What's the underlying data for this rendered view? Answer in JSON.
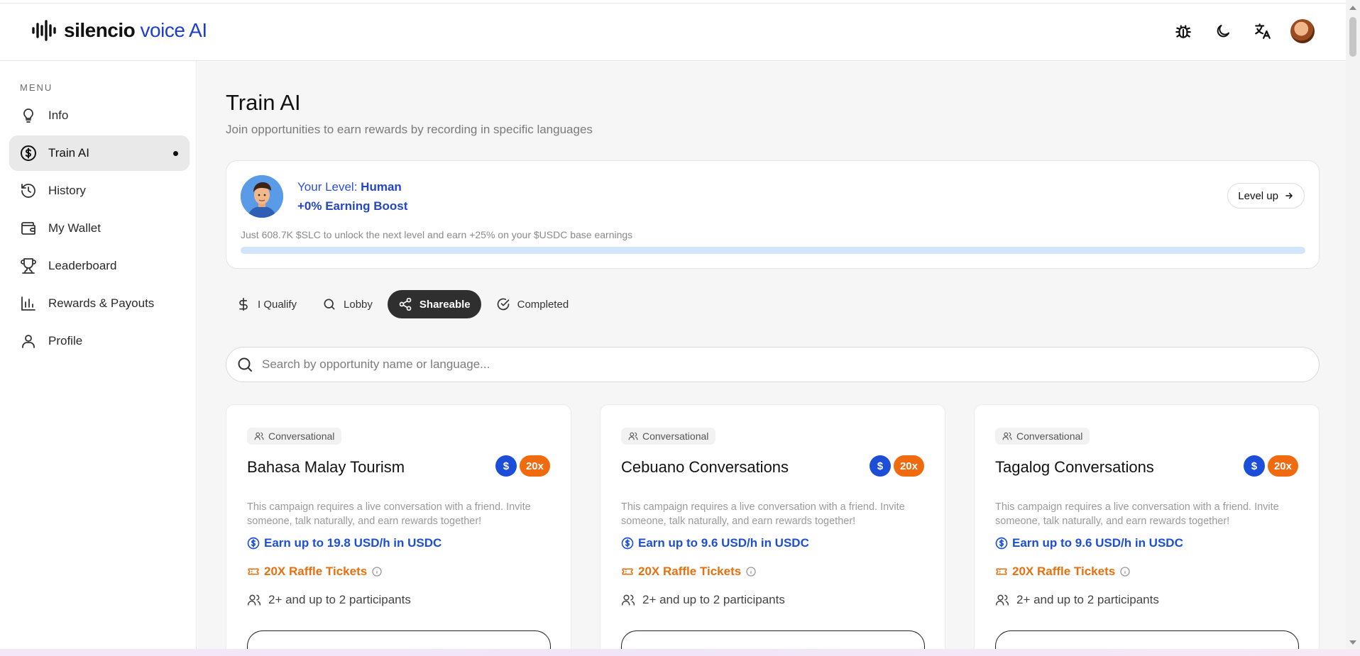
{
  "brand": {
    "name_bold": "silencio",
    "name_rest": " voice AI"
  },
  "header": {
    "icons": [
      "bug-icon",
      "moon-icon",
      "translate-icon",
      "avatar"
    ]
  },
  "sidebar": {
    "menu_label": "MENU",
    "items": [
      {
        "label": "Info",
        "icon": "lightbulb-icon",
        "active": false
      },
      {
        "label": "Train AI",
        "icon": "dollar-circle-icon",
        "active": true
      },
      {
        "label": "History",
        "icon": "history-icon",
        "active": false
      },
      {
        "label": "My Wallet",
        "icon": "wallet-icon",
        "active": false
      },
      {
        "label": "Leaderboard",
        "icon": "trophy-icon",
        "active": false
      },
      {
        "label": "Rewards & Payouts",
        "icon": "bar-chart-icon",
        "active": false
      },
      {
        "label": "Profile",
        "icon": "user-icon",
        "active": false
      }
    ]
  },
  "main": {
    "title": "Train AI",
    "subtitle": "Join opportunities to earn rewards by recording in specific languages"
  },
  "level": {
    "prefix": "Your Level: ",
    "name": "Human",
    "boost": "+0% Earning Boost",
    "note": "Just 608.7K $SLC to unlock the next level and earn +25% on your $USDC base earnings",
    "progress_fraction": 0.0,
    "button_label": "Level up"
  },
  "tabs": [
    {
      "label": "I Qualify",
      "icon": "dollar-icon",
      "active": false
    },
    {
      "label": "Lobby",
      "icon": "search-icon",
      "active": false
    },
    {
      "label": "Shareable",
      "icon": "share-icon",
      "active": true
    },
    {
      "label": "Completed",
      "icon": "check-circle-icon",
      "active": false
    }
  ],
  "search": {
    "placeholder": "Search by opportunity name or language...",
    "value": ""
  },
  "cards": [
    {
      "category": "Conversational",
      "title": "Bahasa Malay Tourism",
      "usd_badge": "$",
      "multiplier": "20x",
      "description": "This campaign requires a live conversation with a friend. Invite someone, talk naturally, and earn rewards together!",
      "earn": "Earn up to 19.8 USD/h in USDC",
      "raffle": "20X Raffle Tickets",
      "participants": "2+ and up to 2 participants"
    },
    {
      "category": "Conversational",
      "title": "Cebuano Conversations",
      "usd_badge": "$",
      "multiplier": "20x",
      "description": "This campaign requires a live conversation with a friend. Invite someone, talk naturally, and earn rewards together!",
      "earn": "Earn up to 9.6 USD/h in USDC",
      "raffle": "20X Raffle Tickets",
      "participants": "2+ and up to 2 participants"
    },
    {
      "category": "Conversational",
      "title": "Tagalog Conversations",
      "usd_badge": "$",
      "multiplier": "20x",
      "description": "This campaign requires a live conversation with a friend. Invite someone, talk naturally, and earn rewards together!",
      "earn": "Earn up to 9.6 USD/h in USDC",
      "raffle": "20X Raffle Tickets",
      "participants": "2+ and up to 2 participants"
    }
  ],
  "colors": {
    "accent_blue": "#1d4fd6",
    "accent_orange": "#f06a0f",
    "active_tab": "#2f2f2f"
  }
}
